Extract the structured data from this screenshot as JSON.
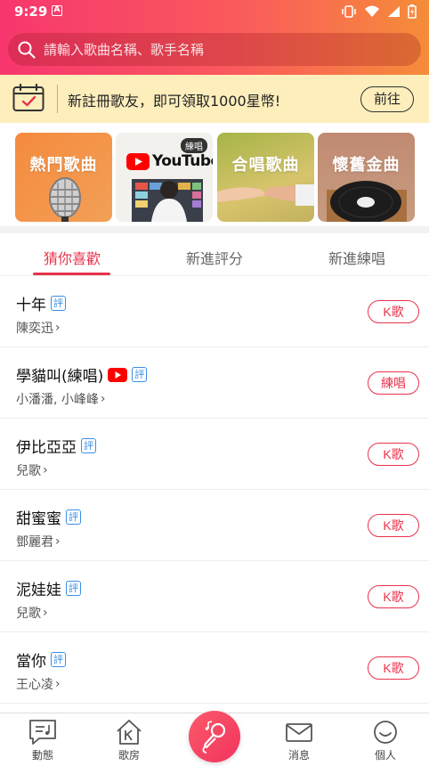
{
  "status": {
    "time": "9:29",
    "app_badge": "A"
  },
  "search": {
    "placeholder": "請輸入歌曲名稱、歌手名稱"
  },
  "promo": {
    "text": "新註冊歌友，即可領取1000星幣!",
    "button": "前往"
  },
  "categories": [
    {
      "title": "熱門歌曲"
    },
    {
      "title": "YouTube",
      "chip": "練唱"
    },
    {
      "title": "合唱歌曲"
    },
    {
      "title": "懷舊金曲"
    }
  ],
  "tabs": [
    {
      "label": "猜你喜歡",
      "active": true
    },
    {
      "label": "新進評分"
    },
    {
      "label": "新進練唱"
    }
  ],
  "songs": [
    {
      "name": "十年",
      "tag": "評",
      "artist": "陳奕迅",
      "button": "K歌"
    },
    {
      "name": "學貓叫(練唱)",
      "tag": "評",
      "youtube": true,
      "artist": "小潘潘, 小峰峰",
      "button": "練唱"
    },
    {
      "name": "伊比亞亞",
      "tag": "評",
      "artist": "兒歌",
      "button": "K歌"
    },
    {
      "name": "甜蜜蜜",
      "tag": "評",
      "artist": "鄧麗君",
      "button": "K歌"
    },
    {
      "name": "泥娃娃",
      "tag": "評",
      "artist": "兒歌",
      "button": "K歌"
    },
    {
      "name": "當你",
      "tag": "評",
      "artist": "王心凌",
      "button": "K歌"
    }
  ],
  "bottom_nav": [
    {
      "label": "動態"
    },
    {
      "label": "歌房"
    },
    {
      "label": "消息"
    },
    {
      "label": "個人"
    }
  ],
  "colors": {
    "accent": "#e8334d",
    "tag_blue": "#3a8ee6",
    "promo_bg": "#fdeebc"
  }
}
